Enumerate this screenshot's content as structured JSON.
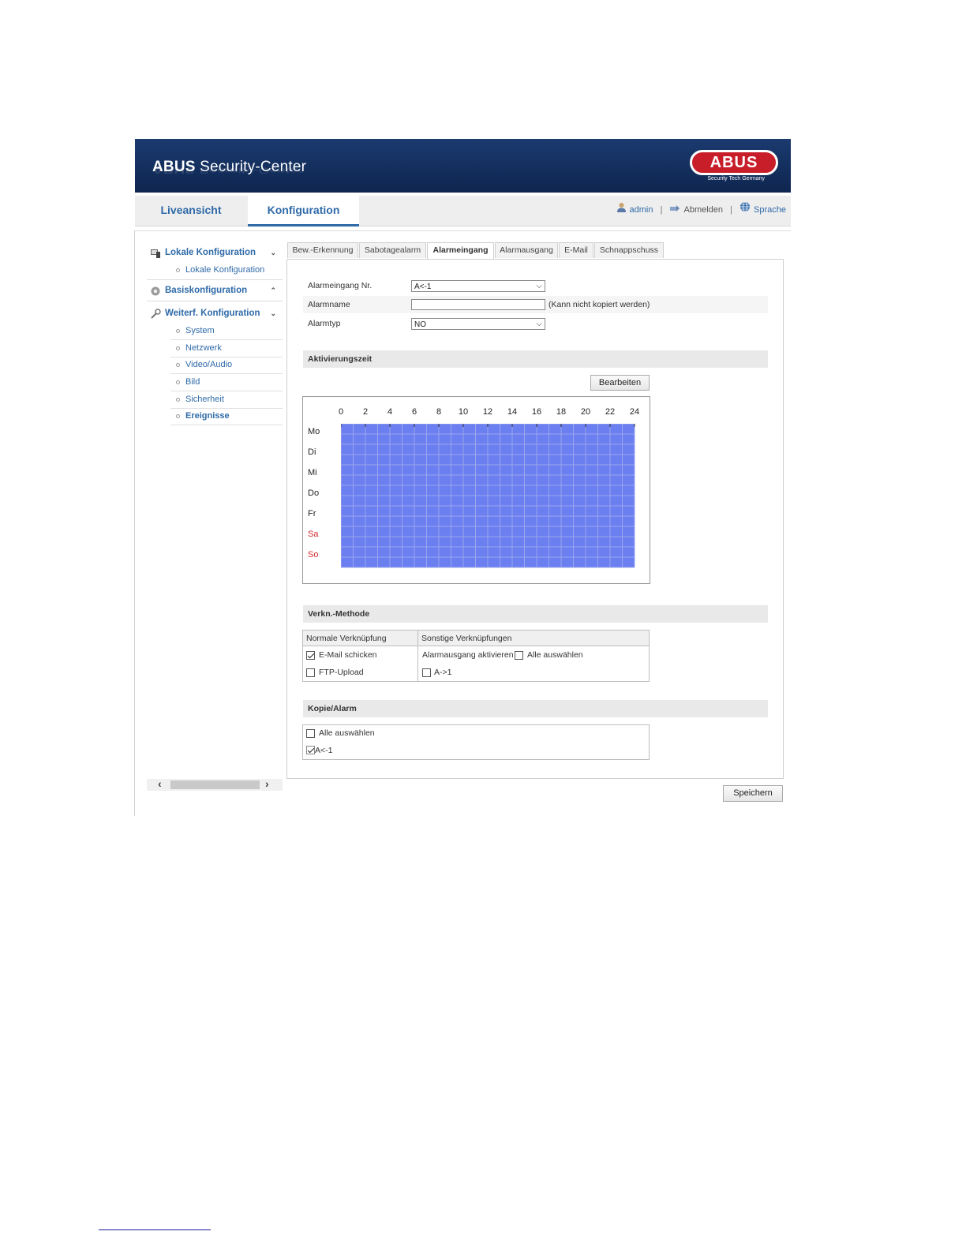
{
  "header": {
    "brand_bold": "ABUS",
    "brand_rest": " Security-Center",
    "logo_text": "ABUS",
    "logo_tagline": "Security Tech Germany",
    "colors": {
      "banner": "#14305f",
      "logo_red": "#c81e2a",
      "accent": "#2f6aa8"
    }
  },
  "topnav": {
    "live": "Liveansicht",
    "config": "Konfiguration",
    "user": "admin",
    "logout": "Abmelden",
    "language": "Sprache",
    "separator": "|"
  },
  "sidebar": {
    "sections": [
      {
        "label": "Lokale Konfiguration",
        "icon": "computer-icon",
        "chevron": "⌄"
      },
      {
        "label": "Basiskonfiguration",
        "icon": "gear-icon",
        "chevron": "⌃"
      },
      {
        "label": "Weiterf. Konfiguration",
        "icon": "wrench-icon",
        "chevron": "⌄"
      }
    ],
    "local_items": [
      "Lokale Konfiguration"
    ],
    "advanced_items": [
      "System",
      "Netzwerk",
      "Video/Audio",
      "Bild",
      "Sicherheit",
      "Ereignisse"
    ],
    "active_item": "Ereignisse"
  },
  "tabs": [
    "Bew.-Erkennung",
    "Sabotagealarm",
    "Alarmeingang",
    "Alarmausgang",
    "E-Mail",
    "Schnappschuss"
  ],
  "active_tab": "Alarmeingang",
  "form": {
    "alarm_input_label": "Alarmeingang Nr.",
    "alarm_input_value": "A<-1",
    "alarm_name_label": "Alarmname",
    "alarm_name_value": "",
    "alarm_name_note": "(Kann nicht kopiert werden)",
    "alarm_type_label": "Alarmtyp",
    "alarm_type_value": "NO"
  },
  "schedule": {
    "section_title": "Aktivierungszeit",
    "edit_button": "Bearbeiten",
    "hours": [
      "0",
      "2",
      "4",
      "6",
      "8",
      "10",
      "12",
      "14",
      "16",
      "18",
      "20",
      "22",
      "24"
    ],
    "days": [
      "Mo",
      "Di",
      "Mi",
      "Do",
      "Fr",
      "Sa",
      "So"
    ],
    "weekend_days": [
      "Sa",
      "So"
    ],
    "active_color": "#6b7ff0",
    "grid_line_color": "#9aa6ee",
    "coverage": "full"
  },
  "linkage": {
    "section_title": "Verkn.-Methode",
    "normal_header": "Normale Verknüpfung",
    "other_header": "Sonstige Verknüpfungen",
    "email": {
      "label": "E-Mail schicken",
      "checked": true
    },
    "ftp": {
      "label": "FTP-Upload",
      "checked": false
    },
    "output_label": "Alarmausgang aktivieren",
    "select_all": {
      "label": "Alle auswählen",
      "checked": false
    },
    "output_a1": {
      "label": "A->1",
      "checked": false
    }
  },
  "copy": {
    "section_title": "Kopie/Alarm",
    "select_all": {
      "label": "Alle auswählen",
      "checked": false
    },
    "a1": {
      "label": "A<-1",
      "checked": true
    }
  },
  "save_button": "Speichern"
}
